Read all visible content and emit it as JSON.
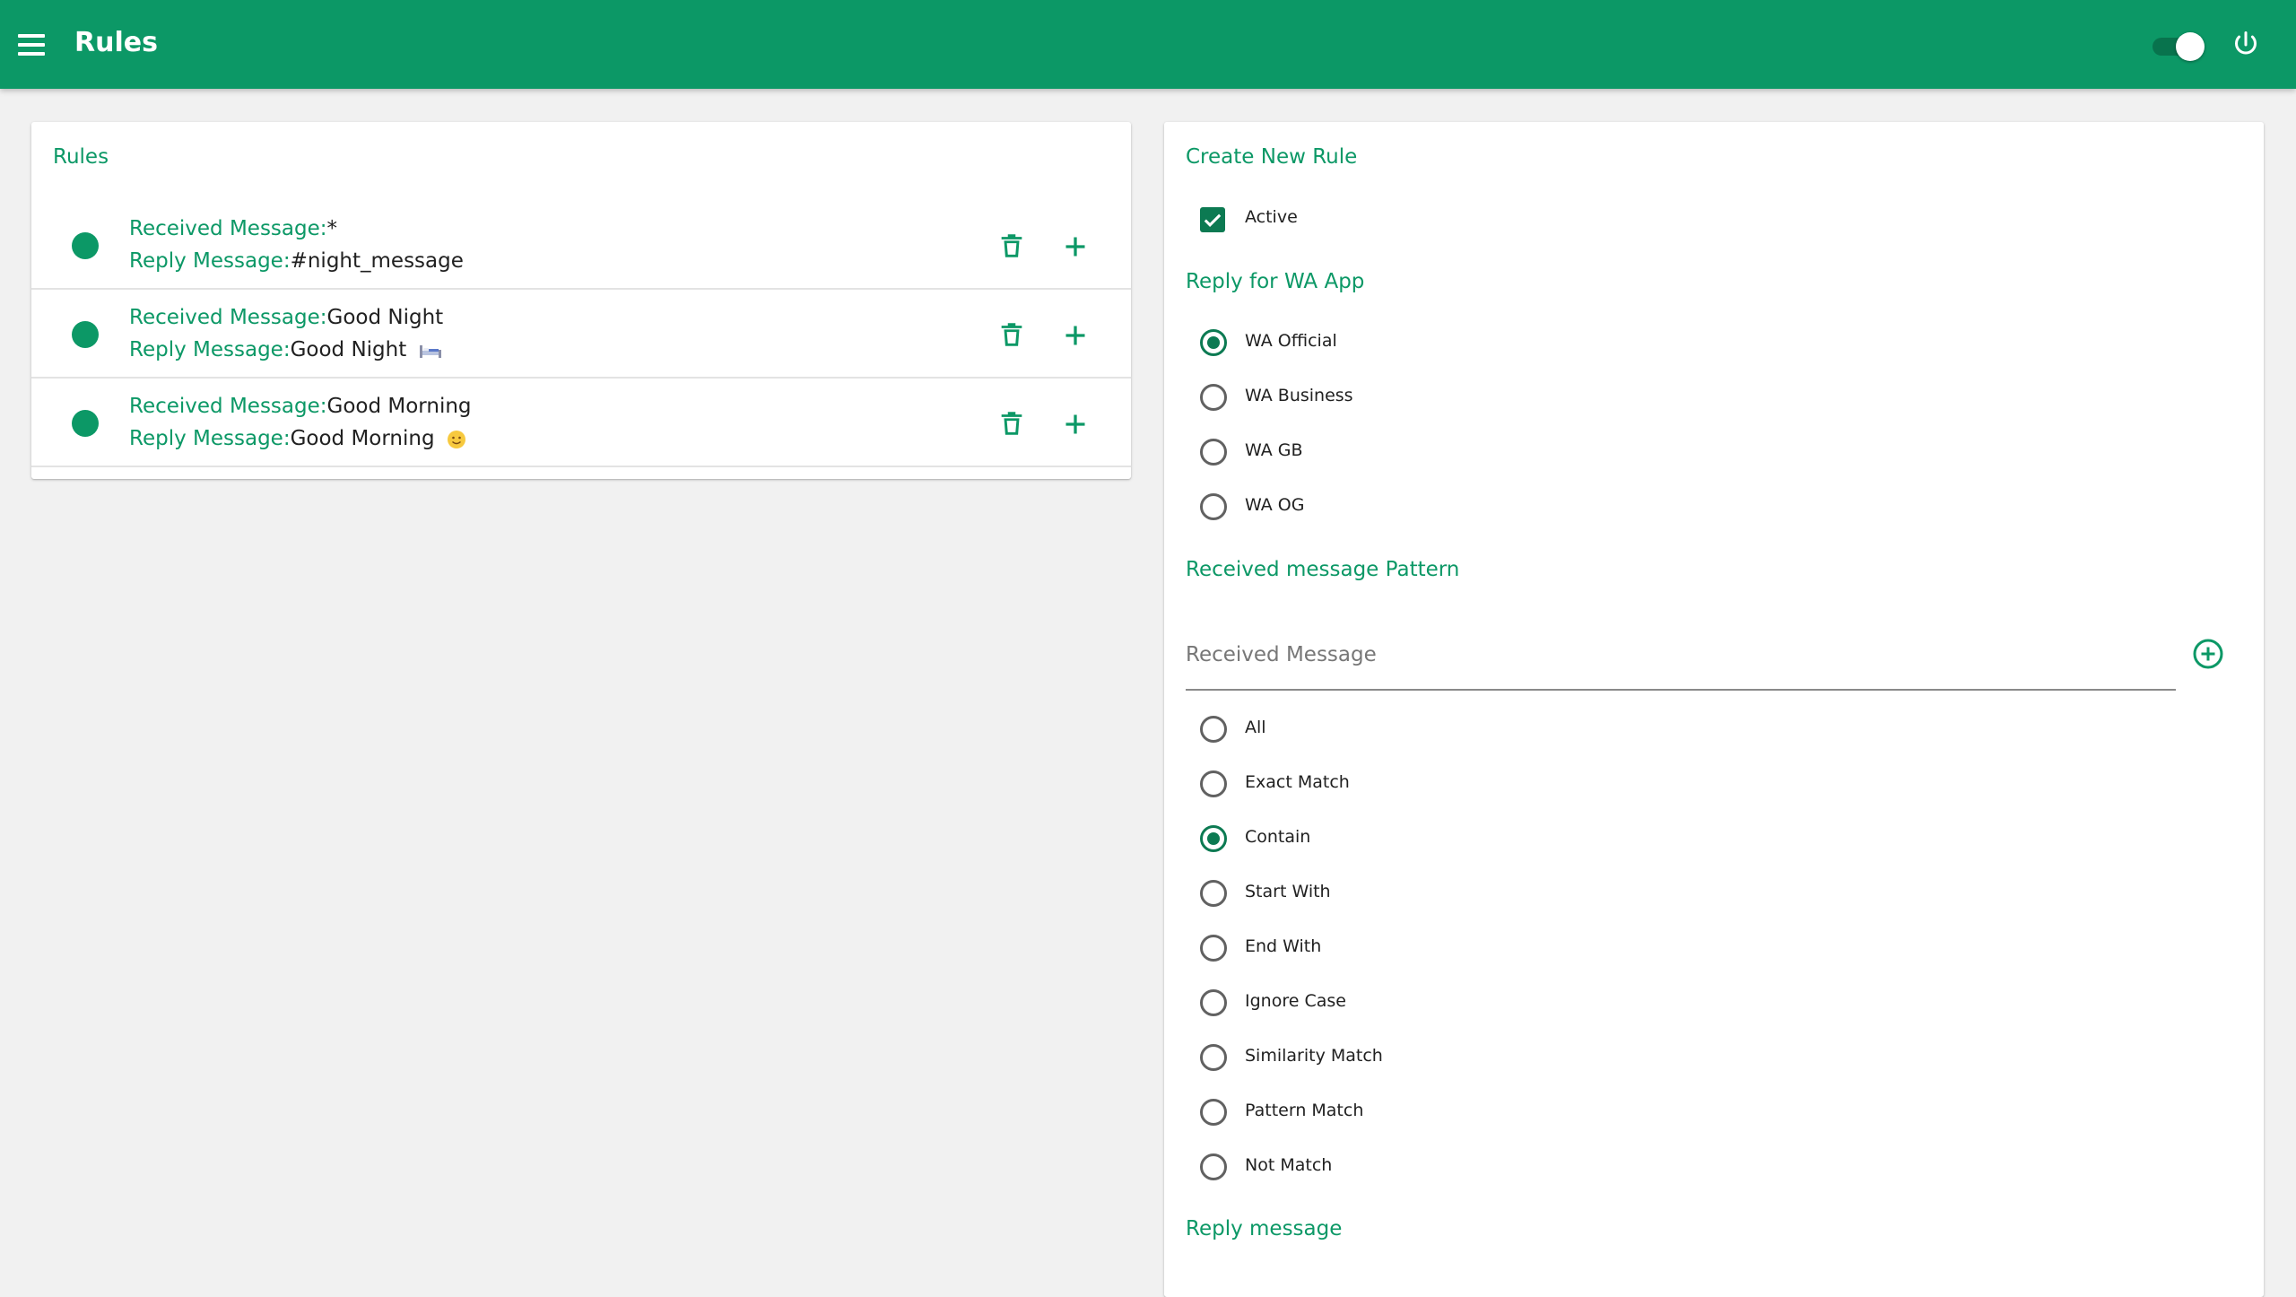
{
  "appbar": {
    "title": "Rules",
    "menu_icon": "menu-icon",
    "toggle_on": true,
    "power_icon": "power-icon"
  },
  "colors": {
    "primary": "#0c9866",
    "primary_dark": "#0c7a52",
    "background": "#f1f1f1",
    "card": "#ffffff"
  },
  "rules_card": {
    "title": "Rules",
    "received_label": "Received Message:",
    "reply_label": "Reply Message:",
    "rules": [
      {
        "received": "*",
        "reply": "#night_message",
        "reply_emoji": ""
      },
      {
        "received": "Good Night",
        "reply": "Good Night",
        "reply_emoji": "bed-emoji"
      },
      {
        "received": "Good Morning",
        "reply": "Good Morning",
        "reply_emoji": "smiling-face-emoji"
      }
    ]
  },
  "create_card": {
    "title": "Create New Rule",
    "active_label": "Active",
    "active_checked": true,
    "wa_app_heading": "Reply for WA App",
    "wa_apps": [
      {
        "label": "WA Official",
        "selected": true
      },
      {
        "label": "WA Business",
        "selected": false
      },
      {
        "label": "WA GB",
        "selected": false
      },
      {
        "label": "WA OG",
        "selected": false
      }
    ],
    "pattern_heading": "Received message Pattern",
    "received_placeholder": "Received Message",
    "received_value": "",
    "match_options": [
      {
        "label": "All",
        "selected": false
      },
      {
        "label": "Exact Match",
        "selected": false
      },
      {
        "label": "Contain",
        "selected": true
      },
      {
        "label": "Start With",
        "selected": false
      },
      {
        "label": "End With",
        "selected": false
      },
      {
        "label": "Ignore Case",
        "selected": false
      },
      {
        "label": "Similarity Match",
        "selected": false
      },
      {
        "label": "Pattern Match",
        "selected": false
      },
      {
        "label": "Not Match",
        "selected": false
      }
    ],
    "reply_heading": "Reply message"
  }
}
